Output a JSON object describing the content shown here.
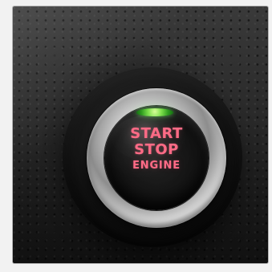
{
  "button": {
    "line1": "START",
    "line2": "STOP",
    "line3": "ENGINE"
  },
  "colors": {
    "label": "#ff6b86",
    "indicator": "#7be04a",
    "background": "#f2f2f2"
  }
}
